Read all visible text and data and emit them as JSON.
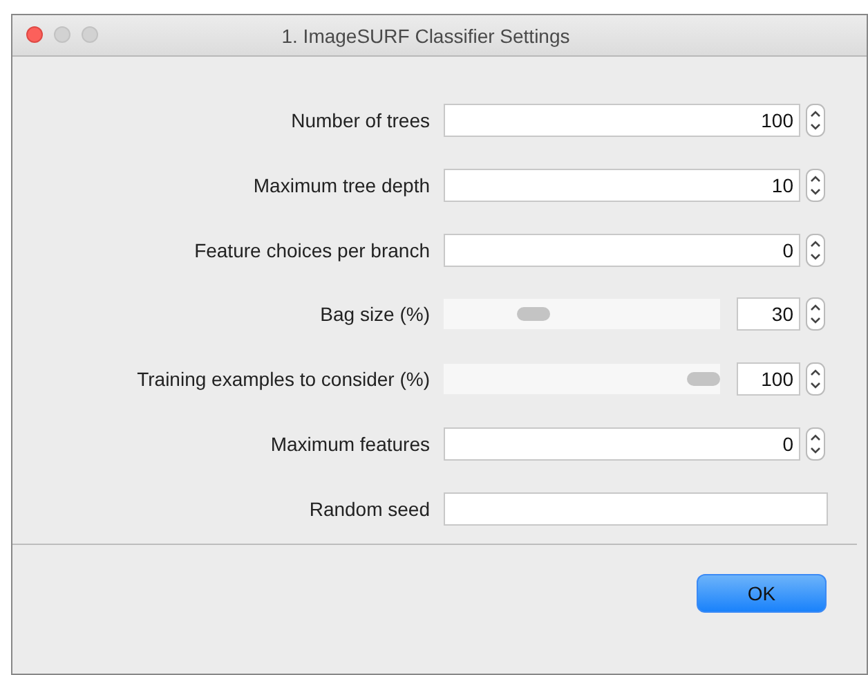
{
  "window": {
    "title": "1. ImageSURF Classifier Settings"
  },
  "settings": [
    {
      "kind": "spinner",
      "label": "Number of trees",
      "value": "100"
    },
    {
      "kind": "spinner",
      "label": "Maximum tree depth",
      "value": "10"
    },
    {
      "kind": "spinner",
      "label": "Feature choices per branch",
      "value": "0"
    },
    {
      "kind": "slider",
      "label": "Bag size (%)",
      "value": "30",
      "level": 0.3
    },
    {
      "kind": "slider",
      "label": "Training examples to consider (%)",
      "value": "100",
      "level": 1
    },
    {
      "kind": "spinner",
      "label": "Maximum features",
      "value": "0"
    },
    {
      "kind": "text",
      "label": "Random seed"
    }
  ],
  "buttons": [
    "OK"
  ]
}
